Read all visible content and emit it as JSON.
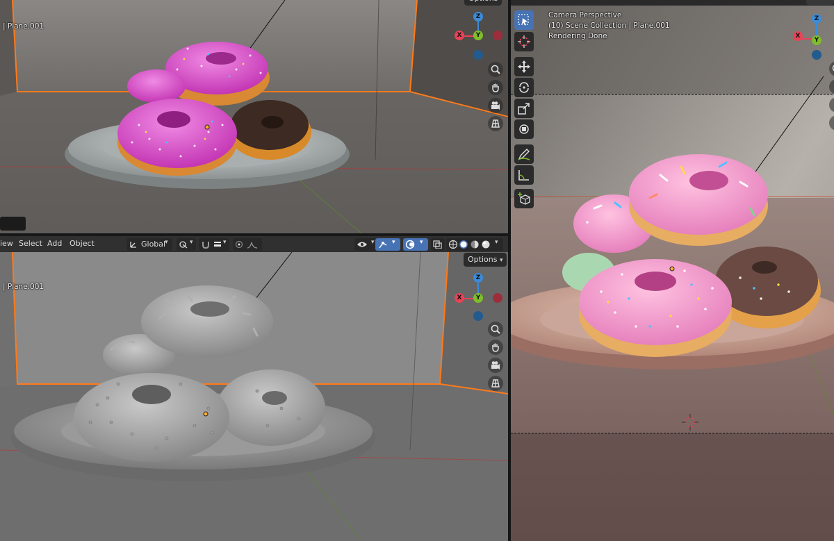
{
  "colors": {
    "axis_x": "#e94257",
    "axis_y": "#7fbd2b",
    "axis_z": "#3b8bd9",
    "active_outline": "#ff7a1a",
    "header_bg": "#303030",
    "tool_active": "#4772b3"
  },
  "top_viewport": {
    "object_label": "| Plane.001",
    "options_label": "Options"
  },
  "header": {
    "menu_view": "iew",
    "menu_select": "Select",
    "menu_add": "Add",
    "menu_object": "Object",
    "orientation": "Global"
  },
  "bottom_viewport": {
    "object_label": "| Plane.001",
    "options_label": "Options"
  },
  "right_viewport": {
    "view_name": "Camera Perspective",
    "collection_line": "(10) Scene Collection | Plane.001",
    "status_line": "Rendering Done"
  },
  "gizmo": {
    "x": "X",
    "y": "Y",
    "z": "Z"
  },
  "toolbar_icons": [
    "select-box-icon",
    "cursor-icon",
    "move-icon",
    "rotate-icon",
    "scale-icon",
    "transform-icon",
    "annotate-icon",
    "measure-icon",
    "add-cube-icon"
  ]
}
